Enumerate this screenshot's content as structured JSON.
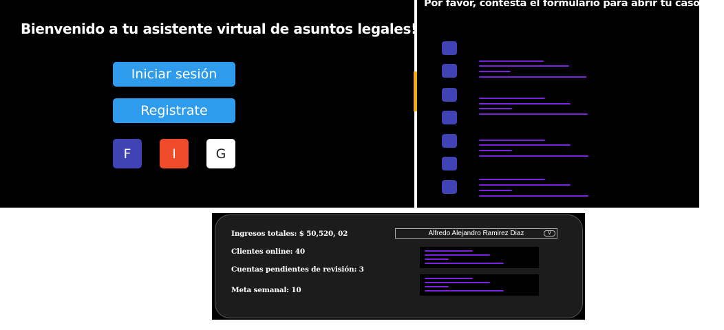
{
  "login": {
    "title": "Bienvenido a tu asistente virtual de asuntos legales!",
    "login_label": "Iniciar sesión",
    "register_label": "Registrate",
    "social": [
      {
        "label": "F",
        "color": "#3f43b4"
      },
      {
        "label": "I",
        "color": "#ef4a2a"
      },
      {
        "label": "G",
        "color": "#ffffff"
      }
    ]
  },
  "form": {
    "title": "Por favor, contesta el formulario para abrir tu caso."
  },
  "dashboard": {
    "income": "Ingresos totales: $ 50,520, 02",
    "online": "Clientes online: 40",
    "pending": "Cuentas pendientes de revisión: 3",
    "goal": "Meta semanal: 10",
    "user_selected": "Alfredo Alejandro Ramirez Diaz",
    "user_arrow": "V"
  },
  "colors": {
    "accent_blue": "#2f9bec",
    "checkbox": "#3f43b4",
    "placeholder_line": "#7b22e0",
    "accent_strip": "#f2a922"
  }
}
